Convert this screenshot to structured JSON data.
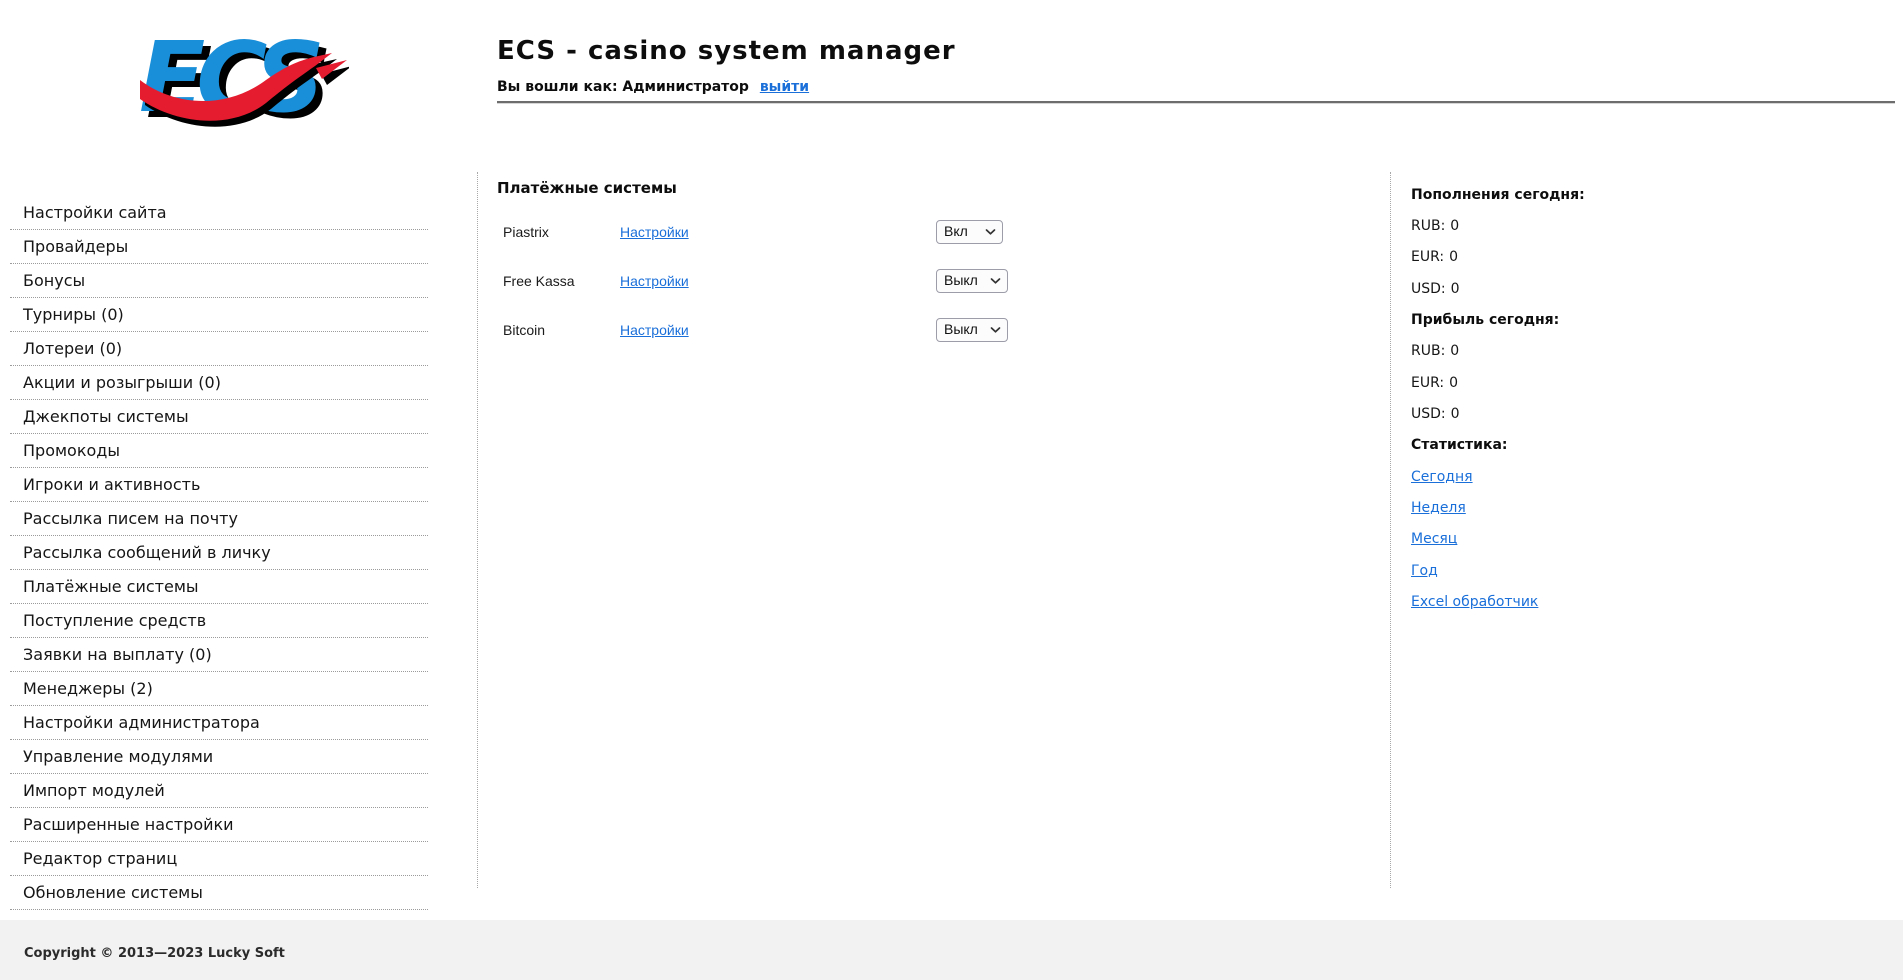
{
  "header": {
    "logo_text": "ECS",
    "title": "ECS - casino system manager",
    "login_label": "Вы вошли как: Администратор",
    "logout_link": "выйти"
  },
  "sidebar": {
    "items": [
      {
        "label": "Настройки сайта"
      },
      {
        "label": "Провайдеры"
      },
      {
        "label": "Бонусы"
      },
      {
        "label": "Турниры (0)"
      },
      {
        "label": "Лотереи (0)"
      },
      {
        "label": "Акции и розыгрыши (0)"
      },
      {
        "label": "Джекпоты системы"
      },
      {
        "label": "Промокоды"
      },
      {
        "label": "Игроки и активность"
      },
      {
        "label": "Рассылка писем на почту"
      },
      {
        "label": "Рассылка сообщений в личку"
      },
      {
        "label": "Платёжные системы"
      },
      {
        "label": "Поступление средств"
      },
      {
        "label": "Заявки на выплату (0)"
      },
      {
        "label": "Менеджеры (2)"
      },
      {
        "label": "Настройки администратора"
      },
      {
        "label": "Управление модулями"
      },
      {
        "label": "Импорт модулей"
      },
      {
        "label": "Расширенные настройки"
      },
      {
        "label": "Редактор страниц"
      },
      {
        "label": "Обновление системы"
      }
    ]
  },
  "main": {
    "title": "Платёжные системы",
    "rows": [
      {
        "name": "Piastrix",
        "link": "Настройки",
        "state": "Вкл"
      },
      {
        "name": "Free Kassa",
        "link": "Настройки",
        "state": "Выкл"
      },
      {
        "name": "Bitcoin",
        "link": "Настройки",
        "state": "Выкл"
      }
    ]
  },
  "stats": {
    "deposits_title": "Пополнения сегодня:",
    "deposits": [
      {
        "label": "RUB:",
        "value": "0"
      },
      {
        "label": "EUR:",
        "value": "0"
      },
      {
        "label": "USD:",
        "value": "0"
      }
    ],
    "profit_title": "Прибыль сегодня:",
    "profit": [
      {
        "label": "RUB:",
        "value": "0"
      },
      {
        "label": "EUR:",
        "value": "0"
      },
      {
        "label": "USD:",
        "value": "0"
      }
    ],
    "stats_title": "Статистика:",
    "links": [
      {
        "label": "Сегодня"
      },
      {
        "label": "Неделя"
      },
      {
        "label": "Месяц"
      },
      {
        "label": "Год"
      },
      {
        "label": "Excel обработчик"
      }
    ]
  },
  "footer": {
    "copyright": "Copyright © 2013—2023 Lucky Soft"
  },
  "colors": {
    "link_blue": "#1a6fd9",
    "logo_blue": "#1a8fd9",
    "logo_red": "#e51c30",
    "footer_bg": "#f2f2f2"
  }
}
